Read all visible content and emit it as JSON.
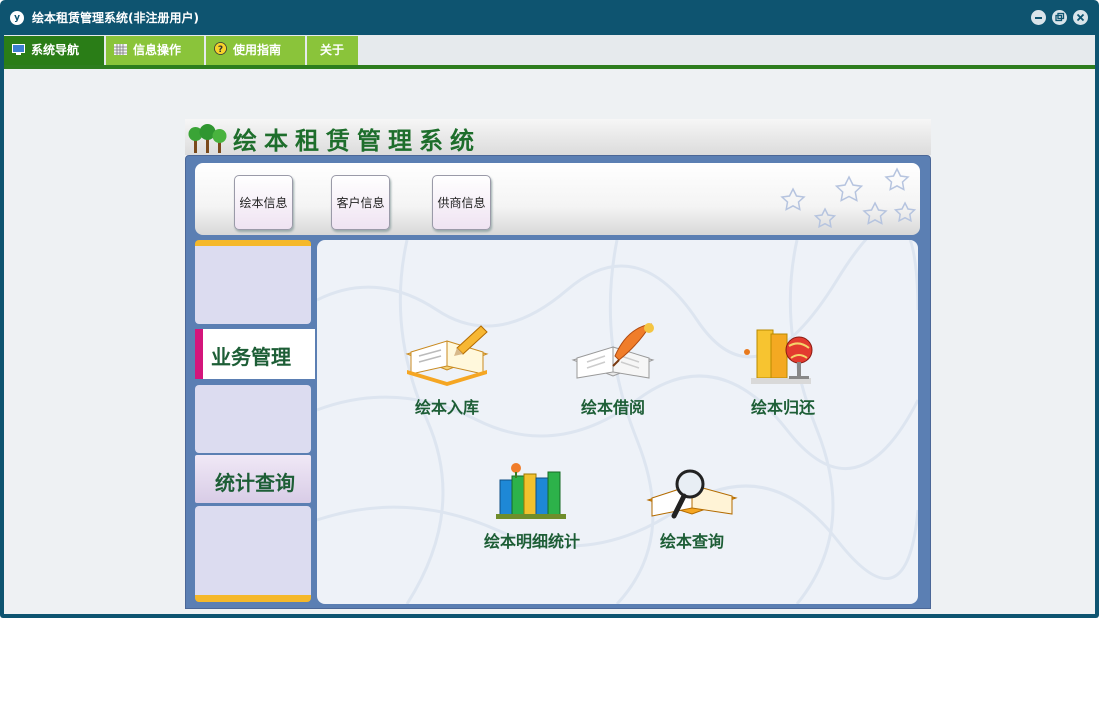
{
  "window": {
    "title": "绘本租赁管理系统(非注册用户)",
    "app_icon_glyph": "y",
    "controls": [
      "minimize-icon",
      "restore-icon",
      "close-icon"
    ]
  },
  "menubar": {
    "items": [
      {
        "label": "系统导航",
        "icon": "monitor-icon",
        "active": true
      },
      {
        "label": "信息操作",
        "icon": "grid-icon",
        "active": false
      },
      {
        "label": "使用指南",
        "icon": "help-icon",
        "active": false
      },
      {
        "label": "关于",
        "active": false
      }
    ]
  },
  "header": {
    "title": "绘本租赁管理系统",
    "logo": "trees-logo"
  },
  "top_buttons": [
    {
      "label": "绘本信息"
    },
    {
      "label": "客户信息"
    },
    {
      "label": "供商信息"
    }
  ],
  "sidebar": {
    "tabs": [
      {
        "label": "业务管理",
        "active": true
      },
      {
        "label": "统计查询",
        "active": false
      }
    ]
  },
  "features": [
    {
      "label": "绘本入库",
      "icon": "book-pencil-icon"
    },
    {
      "label": "绘本借阅",
      "icon": "open-book-quill-icon"
    },
    {
      "label": "绘本归还",
      "icon": "book-stack-globe-icon"
    },
    {
      "label": "绘本明细统计",
      "icon": "bookshelf-icon"
    },
    {
      "label": "绘本查询",
      "icon": "magnifier-book-icon"
    }
  ],
  "colors": {
    "titlebar": "#0e5470",
    "menu_active": "#2a7d17",
    "menu_inactive": "#8ac43a",
    "frame": "#5b7fb3",
    "label_green": "#1d5e36"
  }
}
